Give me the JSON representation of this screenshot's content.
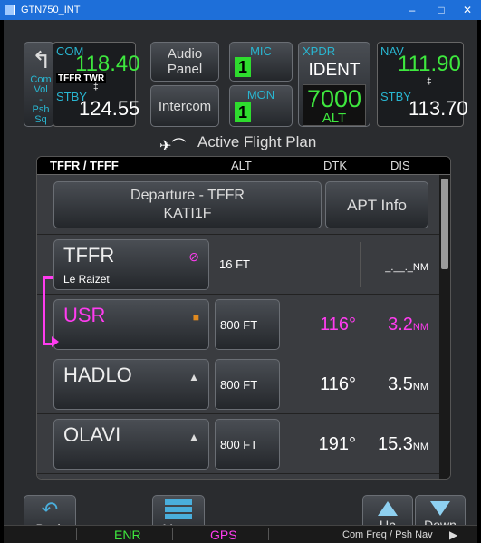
{
  "window": {
    "title": "GTN750_INT",
    "minimize": "–",
    "maximize": "□",
    "close": "✕"
  },
  "radio": {
    "home_lines": [
      "Com",
      "Vol",
      "-",
      "Psh",
      "Sq"
    ],
    "com": {
      "label": "COM",
      "active": "118.40",
      "station": "TFFR TWR",
      "swap": "‡",
      "stby_label": "STBY",
      "standby": "124.55"
    },
    "audio_label_1": "Audio",
    "audio_label_2": "Panel",
    "intercom_label": "Intercom",
    "mic": {
      "label": "MIC",
      "value": "1"
    },
    "mon": {
      "label": "MON",
      "value": "1"
    },
    "xpdr": {
      "label": "XPDR",
      "ident": "IDENT",
      "code": "7000",
      "mode": "ALT"
    },
    "nav": {
      "label": "NAV",
      "active": "111.90",
      "swap": "‡",
      "stby_label": "STBY",
      "standby": "113.70"
    }
  },
  "page": {
    "title": "Active Flight Plan"
  },
  "fpl": {
    "route": "TFFR / TFFF",
    "columns": {
      "alt": "ALT",
      "dtk": "DTK",
      "dis": "DIS"
    },
    "departure": {
      "line1": "Departure - TFFR",
      "line2": "KATI1F"
    },
    "apt_info": "APT Info",
    "waypoints": [
      {
        "name": "TFFR",
        "sub": "Le Raizet",
        "alt": "16 FT",
        "dtk": "",
        "dis": "",
        "dis_unit": "NM",
        "dis_dashes": "_.__._"
      },
      {
        "name": "USR",
        "sub": "",
        "alt": "800 FT",
        "dtk": "116°",
        "dis": "3.2",
        "dis_unit": "NM"
      },
      {
        "name": "HADLO",
        "sub": "",
        "alt": "800 FT",
        "dtk": "116°",
        "dis": "3.5",
        "dis_unit": "NM"
      },
      {
        "name": "OLAVI",
        "sub": "",
        "alt": "800 FT",
        "dtk": "191°",
        "dis": "15.3",
        "dis_unit": "NM"
      }
    ]
  },
  "controls": {
    "back": "Back",
    "menu": "Menu",
    "up": "Up",
    "down": "Down"
  },
  "status": {
    "mode1": "ENR",
    "mode2": "GPS",
    "hint": "Com Freq / Psh Nav",
    "arrow": "▶"
  },
  "colors": {
    "active_green": "#3ee83e",
    "label_cyan": "#29b6d1",
    "active_leg_magenta": "#ff3cf0"
  }
}
